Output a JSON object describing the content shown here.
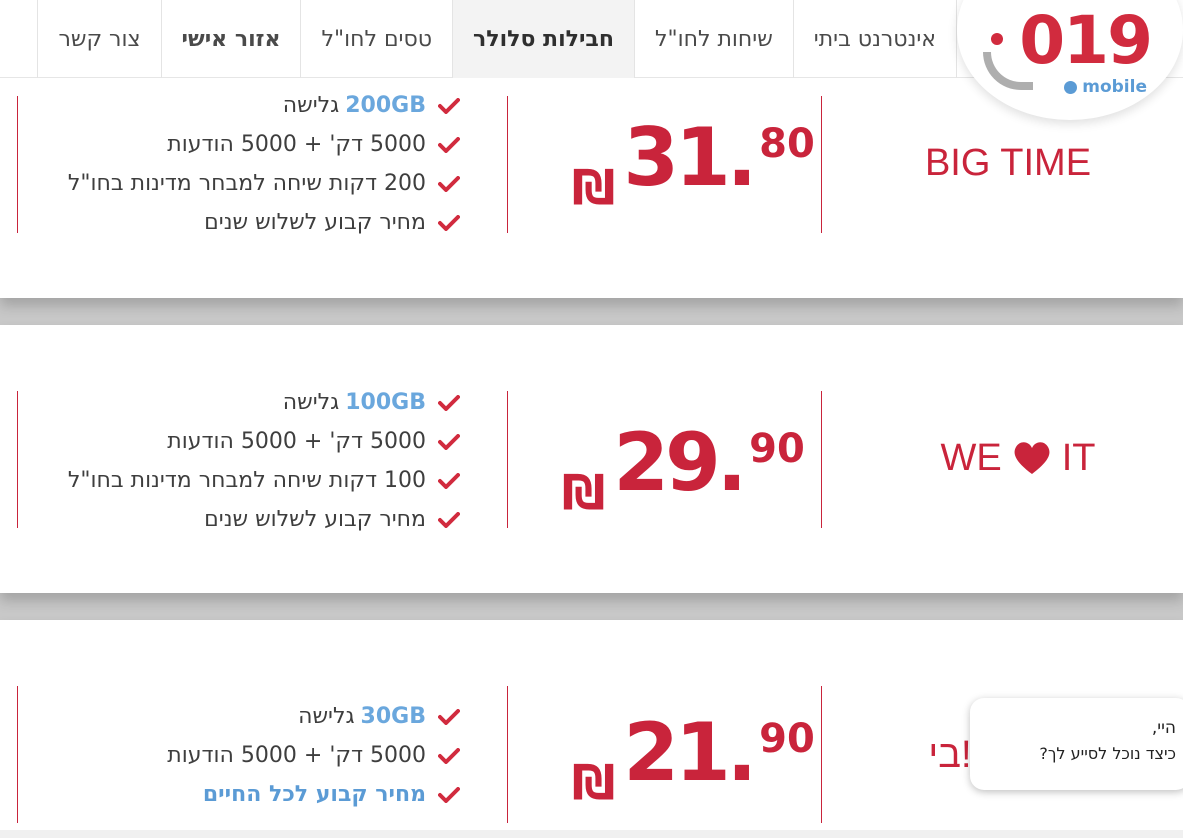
{
  "header": {
    "logo": {
      "number": "019",
      "sub": "mobile"
    },
    "nav": [
      {
        "label": "אינטרנט ביתי",
        "state": "normal"
      },
      {
        "label": "שיחות לחו\"ל",
        "state": "normal"
      },
      {
        "label": "חבילות סלולר",
        "state": "active"
      },
      {
        "label": "טסים לחו\"ל",
        "state": "normal"
      },
      {
        "label": "אזור אישי",
        "state": "bold"
      },
      {
        "label": "צור קשר",
        "state": "normal"
      }
    ]
  },
  "plans": [
    {
      "name": "BIG TIME",
      "price": {
        "currency": "₪",
        "integer": "31.",
        "cents": "80"
      },
      "features": [
        {
          "highlight": "200GB",
          "text": "גלישה"
        },
        {
          "text": "5000 דק' + 5000 הודעות"
        },
        {
          "text": "200 דקות שיחה למבחר מדינות בחו\"ל"
        },
        {
          "text": "מחיר קבוע לשלוש שנים"
        }
      ]
    },
    {
      "name_left": "WE",
      "name_right": "IT",
      "name_icon": "heart-icon",
      "price": {
        "currency": "₪",
        "integer": "29.",
        "cents": "90"
      },
      "features": [
        {
          "highlight": "100GB",
          "text": "גלישה"
        },
        {
          "text": "5000 דק' + 5000 הודעות"
        },
        {
          "text": "100 דקות שיחה למבחר מדינות בחו\"ל"
        },
        {
          "text": "מחיר קבוע לשלוש שנים"
        }
      ]
    },
    {
      "name": "בי!",
      "price": {
        "currency": "₪",
        "integer": "21.",
        "cents": "90"
      },
      "features": [
        {
          "highlight": "30GB",
          "text": "גלישה"
        },
        {
          "text": "5000 דק' + 5000 הודעות"
        },
        {
          "text": "מחיר קבוע לכל החיים",
          "style": "blue"
        }
      ]
    }
  ],
  "chat": {
    "line1": "היי,",
    "line2": "כיצד נוכל לסייע לך?"
  },
  "colors": {
    "brand_red": "#c9243b",
    "brand_blue": "#5b9bd5",
    "check_red": "#d12b3e"
  }
}
